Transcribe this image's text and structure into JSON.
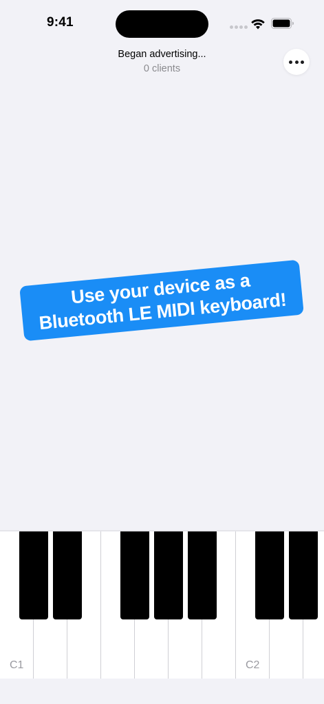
{
  "status_bar": {
    "time": "9:41",
    "signal_icon": "cellular-dots-icon",
    "wifi_icon": "wifi-icon",
    "battery_icon": "battery-icon"
  },
  "header": {
    "advertising_status": "Began advertising...",
    "clients": "0 clients",
    "more_icon": "ellipsis-icon"
  },
  "banner": {
    "line1": "Use your device as a",
    "line2": "Bluetooth LE MIDI keyboard!",
    "color": "#1a8df6"
  },
  "keyboard": {
    "octave_labels": [
      "C1",
      "C2"
    ]
  }
}
